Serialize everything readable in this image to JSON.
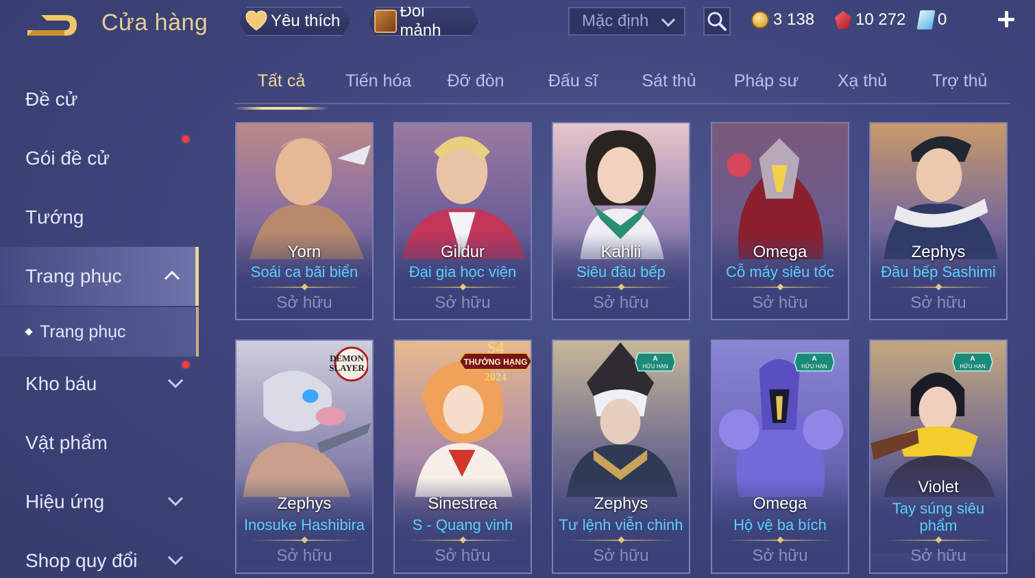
{
  "header": {
    "title": "Cửa hàng",
    "favorites_label": "Yêu thích",
    "fragments_label": "Đổi mảnh",
    "sort_value": "Mặc định",
    "currencies": [
      {
        "name": "coin-icon",
        "value": "3 138"
      },
      {
        "name": "ruby-icon",
        "value": "10 272"
      },
      {
        "name": "voucher-icon",
        "value": "0"
      }
    ]
  },
  "sidebar": {
    "items": [
      {
        "label": "Đề cử"
      },
      {
        "label": "Gói đề cử",
        "dot": true
      },
      {
        "label": "Tướng"
      },
      {
        "label": "Trang phục",
        "expanded": true
      },
      {
        "label": "Trang phục",
        "sub": true
      },
      {
        "label": "Kho báu",
        "dot": true
      },
      {
        "label": "Vật phẩm"
      },
      {
        "label": "Hiệu ứng"
      },
      {
        "label": "Shop quy đổi"
      }
    ]
  },
  "tabs": [
    "Tất cả",
    "Tiến hóa",
    "Đỡ đòn",
    "Đấu sĩ",
    "Sát thủ",
    "Pháp sư",
    "Xạ thủ",
    "Trợ thủ"
  ],
  "active_tab": 0,
  "cards": [
    {
      "hero": "Yorn",
      "skin": "Soái ca bãi biển",
      "status": "Sở hữu"
    },
    {
      "hero": "Gildur",
      "skin": "Đại gia học viện",
      "status": "Sở hữu"
    },
    {
      "hero": "Kahlii",
      "skin": "Siêu đầu bếp",
      "status": "Sở hữu"
    },
    {
      "hero": "Omega",
      "skin": "Cỗ máy siêu tốc",
      "status": "Sở hữu"
    },
    {
      "hero": "Zephys",
      "skin": "Đầu bếp Sashimi",
      "status": "Sở hữu"
    },
    {
      "hero": "Zephys",
      "skin": "Inosuke Hashibira",
      "status": "Sở hữu",
      "badge": "Demon Slayer"
    },
    {
      "hero": "Sinestrea",
      "skin": "S - Quang vinh",
      "status": "Sở hữu",
      "badge_s4": "S4",
      "badge_s4_sub": "THƯỞNG HẠNG",
      "badge_s4_year": "2024"
    },
    {
      "hero": "Zephys",
      "skin": "Tư lệnh viễn chinh",
      "status": "Sở hữu",
      "limited": "HỮU HẠN"
    },
    {
      "hero": "Omega",
      "skin": "Hộ vệ ba bích",
      "status": "Sở hữu",
      "limited": "HỮU HẠN"
    },
    {
      "hero": "Violet",
      "skin": "Tay súng siêu phẩm",
      "status": "Sở hữu",
      "limited": "HỮU HẠN"
    }
  ]
}
